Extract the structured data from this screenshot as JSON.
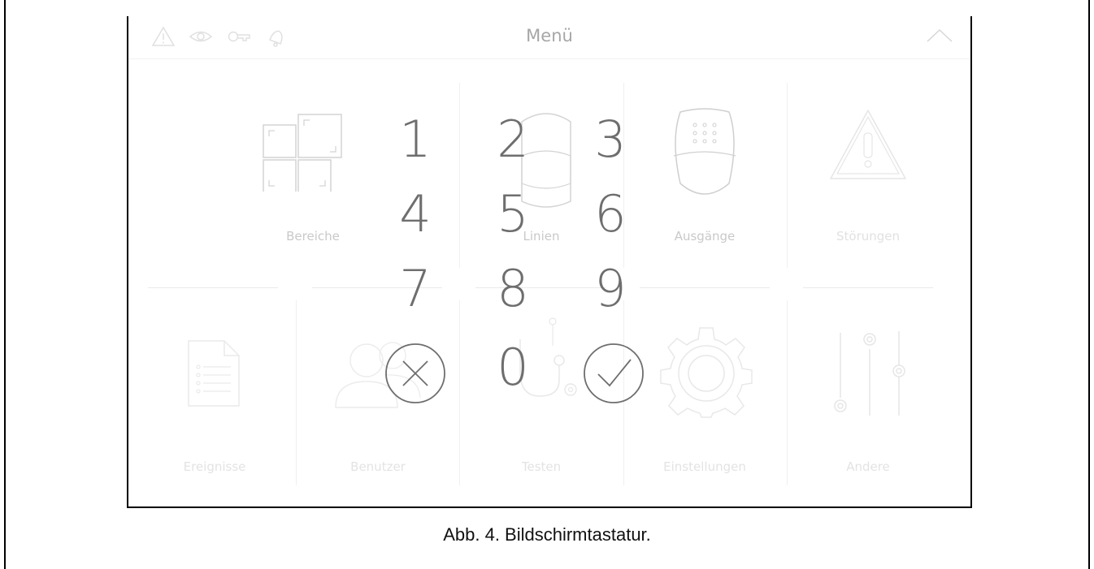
{
  "header": {
    "title": "Menü"
  },
  "status_icons": [
    "warning-icon",
    "eye-icon",
    "key-icon",
    "bell-icon"
  ],
  "tiles": [
    {
      "label": "Bereiche",
      "icon": "partitions-icon"
    },
    {
      "label": "Linien",
      "icon": "detector-icon"
    },
    {
      "label": "Ausgänge",
      "icon": "keyfob-icon"
    },
    {
      "label": "Störungen",
      "icon": "trouble-icon"
    },
    {
      "label": "Ereignisse",
      "icon": "document-list-icon"
    },
    {
      "label": "Benutzer",
      "icon": "users-icon"
    },
    {
      "label": "Testen",
      "icon": "stethoscope-icon"
    },
    {
      "label": "Einstellungen",
      "icon": "gear-icon"
    },
    {
      "label": "Andere",
      "icon": "sliders-icon"
    }
  ],
  "keypad": {
    "keys": [
      "1",
      "2",
      "3",
      "4",
      "5",
      "6",
      "7",
      "8",
      "9",
      "0"
    ],
    "cancel_icon": "cancel-icon",
    "confirm_icon": "confirm-icon"
  },
  "caption": "Abb. 4. Bildschirmtastatur."
}
